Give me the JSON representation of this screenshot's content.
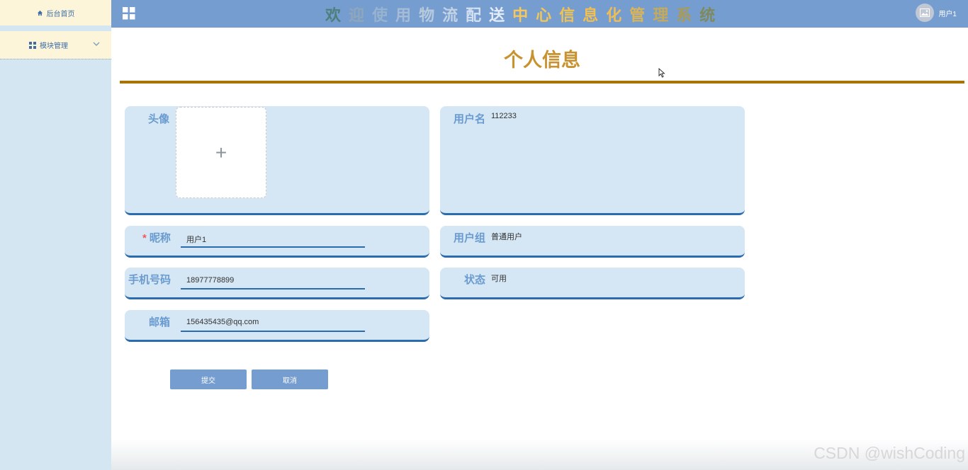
{
  "sidebar": {
    "home_label": "后台首页",
    "module_label": "模块管理",
    "home_icon": "home-icon",
    "module_icon": "grid-icon"
  },
  "header": {
    "title_chars": [
      {
        "ch": "欢",
        "color": "#4f7f7c"
      },
      {
        "ch": "迎",
        "color": "#90a6bb"
      },
      {
        "ch": "使",
        "color": "#98b3cf"
      },
      {
        "ch": "用",
        "color": "#a6bcd6"
      },
      {
        "ch": "物",
        "color": "#b7c9dd"
      },
      {
        "ch": "流",
        "color": "#c2d3e6"
      },
      {
        "ch": "配",
        "color": "#d2dff0"
      },
      {
        "ch": "送",
        "color": "#e2ebf7"
      },
      {
        "ch": "中",
        "color": "#f6c85c"
      },
      {
        "ch": "心",
        "color": "#f2c558"
      },
      {
        "ch": "信",
        "color": "#f0c254"
      },
      {
        "ch": "息",
        "color": "#f2bf51"
      },
      {
        "ch": "化",
        "color": "#efbd55"
      },
      {
        "ch": "管",
        "color": "#d9b458"
      },
      {
        "ch": "理",
        "color": "#c5aa59"
      },
      {
        "ch": "系",
        "color": "#a99a58"
      },
      {
        "ch": "统",
        "color": "#7e8a5b"
      }
    ],
    "user_label": "用户1"
  },
  "page": {
    "title": "个人信息"
  },
  "form": {
    "avatar_label": "头像",
    "username_label": "用户名",
    "username_value": "112233",
    "nickname_label": "昵称",
    "nickname_value": "用户1",
    "required_mark": "*",
    "usergroup_label": "用户组",
    "usergroup_value": "普通用户",
    "phone_label": "手机号码",
    "phone_value": "18977778899",
    "status_label": "状态",
    "status_value": "可用",
    "email_label": "邮箱",
    "email_value": "156435435@qq.com",
    "upload_symbol": "+"
  },
  "buttons": {
    "submit": "提交",
    "cancel": "取消"
  },
  "watermark": "CSDN @wishCoding",
  "colors": {
    "header_bg": "#769dcf",
    "sidebar_bg": "#d5e6f3",
    "sidebar_item_bg": "#fdf5d9",
    "title_color": "#c8922f",
    "rule_color": "#a87404",
    "card_bg": "#d5e6f4",
    "label_color": "#6a9bd0"
  }
}
